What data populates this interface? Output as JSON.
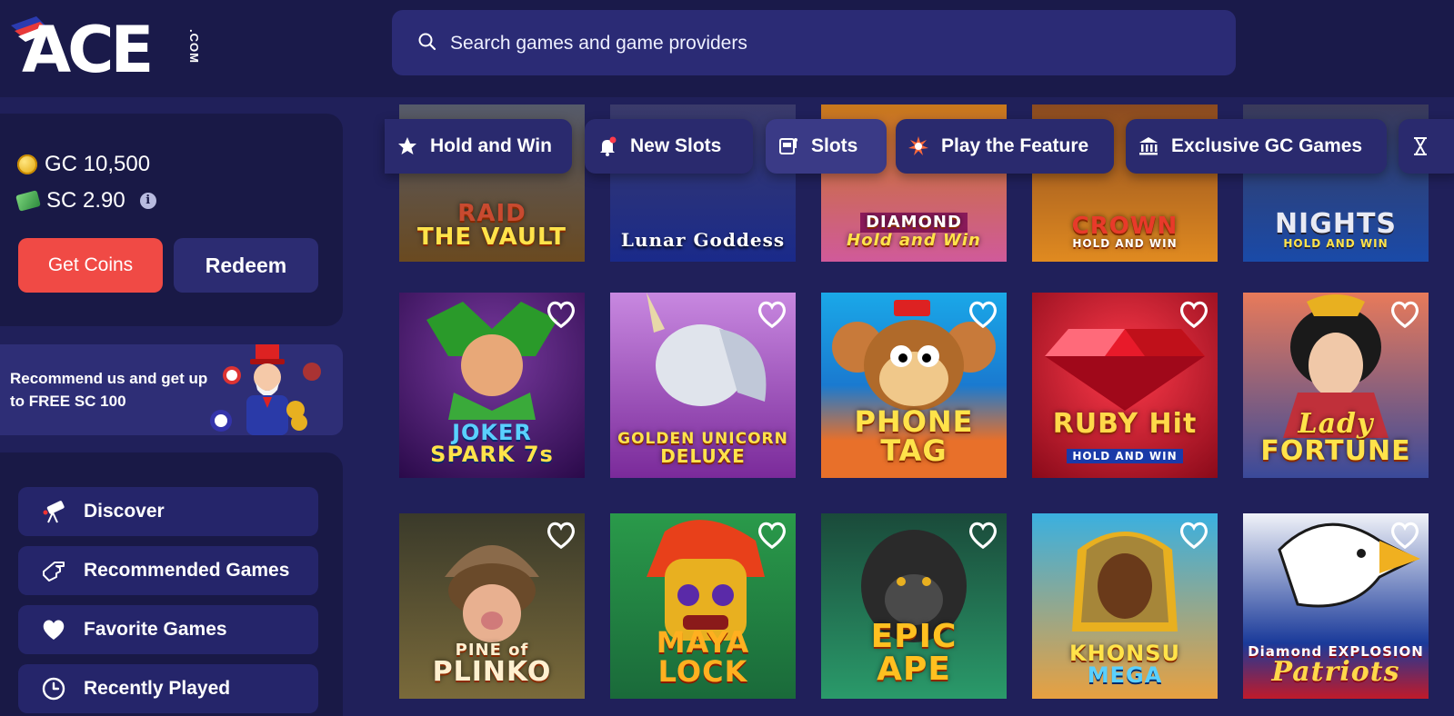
{
  "header": {
    "logo_text": "ACE",
    "logo_suffix": ".COM",
    "search_placeholder": "Search games and game providers"
  },
  "wallet": {
    "gc_balance": "GC 10,500",
    "sc_balance": "SC 2.90",
    "get_coins_label": "Get Coins",
    "redeem_label": "Redeem"
  },
  "promo": {
    "text": "Recommend us and get up to FREE SC 100"
  },
  "sidebar": {
    "items": [
      {
        "label": "Discover",
        "icon": "telescope-icon"
      },
      {
        "label": "Recommended Games",
        "icon": "pointing-hand-icon"
      },
      {
        "label": "Favorite Games",
        "icon": "heart-icon"
      },
      {
        "label": "Recently Played",
        "icon": "clock-icon"
      }
    ]
  },
  "categories": [
    {
      "label": "Hold and Win",
      "icon": "star-icon"
    },
    {
      "label": "New Slots",
      "icon": "bell-icon"
    },
    {
      "label": "Slots",
      "icon": "slot-machine-icon"
    },
    {
      "label": "Play the Feature",
      "icon": "explosion-icon"
    },
    {
      "label": "Exclusive GC Games",
      "icon": "bank-icon"
    },
    {
      "label": "",
      "icon": "hourglass-icon"
    }
  ],
  "games_row1": [
    {
      "title_line1": "RAID",
      "title_line2": "THE VAULT",
      "colors": [
        "#3a3a55",
        "#7a5a20"
      ]
    },
    {
      "title_line1": "",
      "title_line2": "Lunar Goddess",
      "colors": [
        "#2a2a6a",
        "#1a3a8a"
      ]
    },
    {
      "title_line1": "DIAMOND",
      "title_line2": "Hold and Win",
      "colors": [
        "#d27a20",
        "#d35a9a"
      ]
    },
    {
      "title_line1": "CROWN",
      "title_line2": "HOLD AND WIN",
      "colors": [
        "#b06020",
        "#d88a20"
      ]
    },
    {
      "title_line1": "NIGHTS",
      "title_line2": "HOLD AND WIN",
      "colors": [
        "#2a2a50",
        "#1a4aa0"
      ]
    }
  ],
  "games_row2": [
    {
      "title_line1": "JOKER",
      "title_line2": "SPARK 7s",
      "colors": [
        "#3a1a6a",
        "#6a2a8a"
      ]
    },
    {
      "title_line1": "GOLDEN UNICORN",
      "title_line2": "DELUXE",
      "colors": [
        "#b070d0",
        "#7a2a9a"
      ]
    },
    {
      "title_line1": "PHONE",
      "title_line2": "TAG",
      "colors": [
        "#1aa0e0",
        "#e07020"
      ]
    },
    {
      "title_line1": "RUBY Hit",
      "title_line2": "HOLD AND WIN",
      "colors": [
        "#c01030",
        "#e02040"
      ]
    },
    {
      "title_line1": "Lady",
      "title_line2": "FORTUNE",
      "colors": [
        "#e06040",
        "#2a3a8a"
      ]
    }
  ],
  "games_row3": [
    {
      "title_line1": "PINE of",
      "title_line2": "PLINKO",
      "colors": [
        "#3a3a2a",
        "#6a5a3a"
      ]
    },
    {
      "title_line1": "MAYA",
      "title_line2": "LOCK",
      "colors": [
        "#1a8a3a",
        "#3aaa5a"
      ]
    },
    {
      "title_line1": "EPIC",
      "title_line2": "APE",
      "colors": [
        "#1a5a3a",
        "#2a8a5a"
      ]
    },
    {
      "title_line1": "KHONSU",
      "title_line2": "MEGA",
      "colors": [
        "#1a8ab0",
        "#d09030"
      ]
    },
    {
      "title_line1": "Diamond EXPLOSION",
      "title_line2": "Patriots",
      "colors": [
        "#e8eaf0",
        "#c01a2a"
      ]
    }
  ]
}
